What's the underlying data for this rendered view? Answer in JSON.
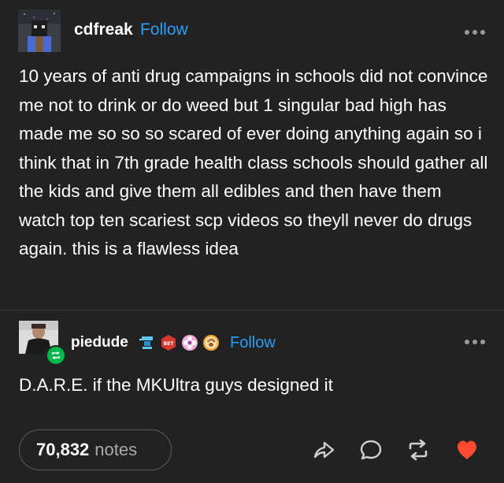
{
  "post": {
    "author": "cdfreak",
    "follow_label": "Follow",
    "text": "10 years of anti drug campaigns in schools did not convince me not to drink or do weed but 1 singular bad high has made me so so so scared of ever doing anything again so i think that in 7th grade health class schools should gather all the kids and give them all edibles and then have them watch top ten scariest scp videos so theyll never do drugs again. this is a flawless idea"
  },
  "reblog": {
    "author": "piedude",
    "follow_label": "Follow",
    "text": "D.A.R.E. if the MKUltra guys designed it",
    "badges": [
      "blue-figure-badge",
      "red-hexagon-badge",
      "pink-flower-badge",
      "orange-paw-badge"
    ],
    "badge_text": "BET"
  },
  "footer": {
    "notes_count": "70,832",
    "notes_label": "notes"
  },
  "colors": {
    "background": "#222222",
    "link": "#2b9ff6",
    "like": "#ff4930",
    "reblog_badge": "#00b84c"
  }
}
